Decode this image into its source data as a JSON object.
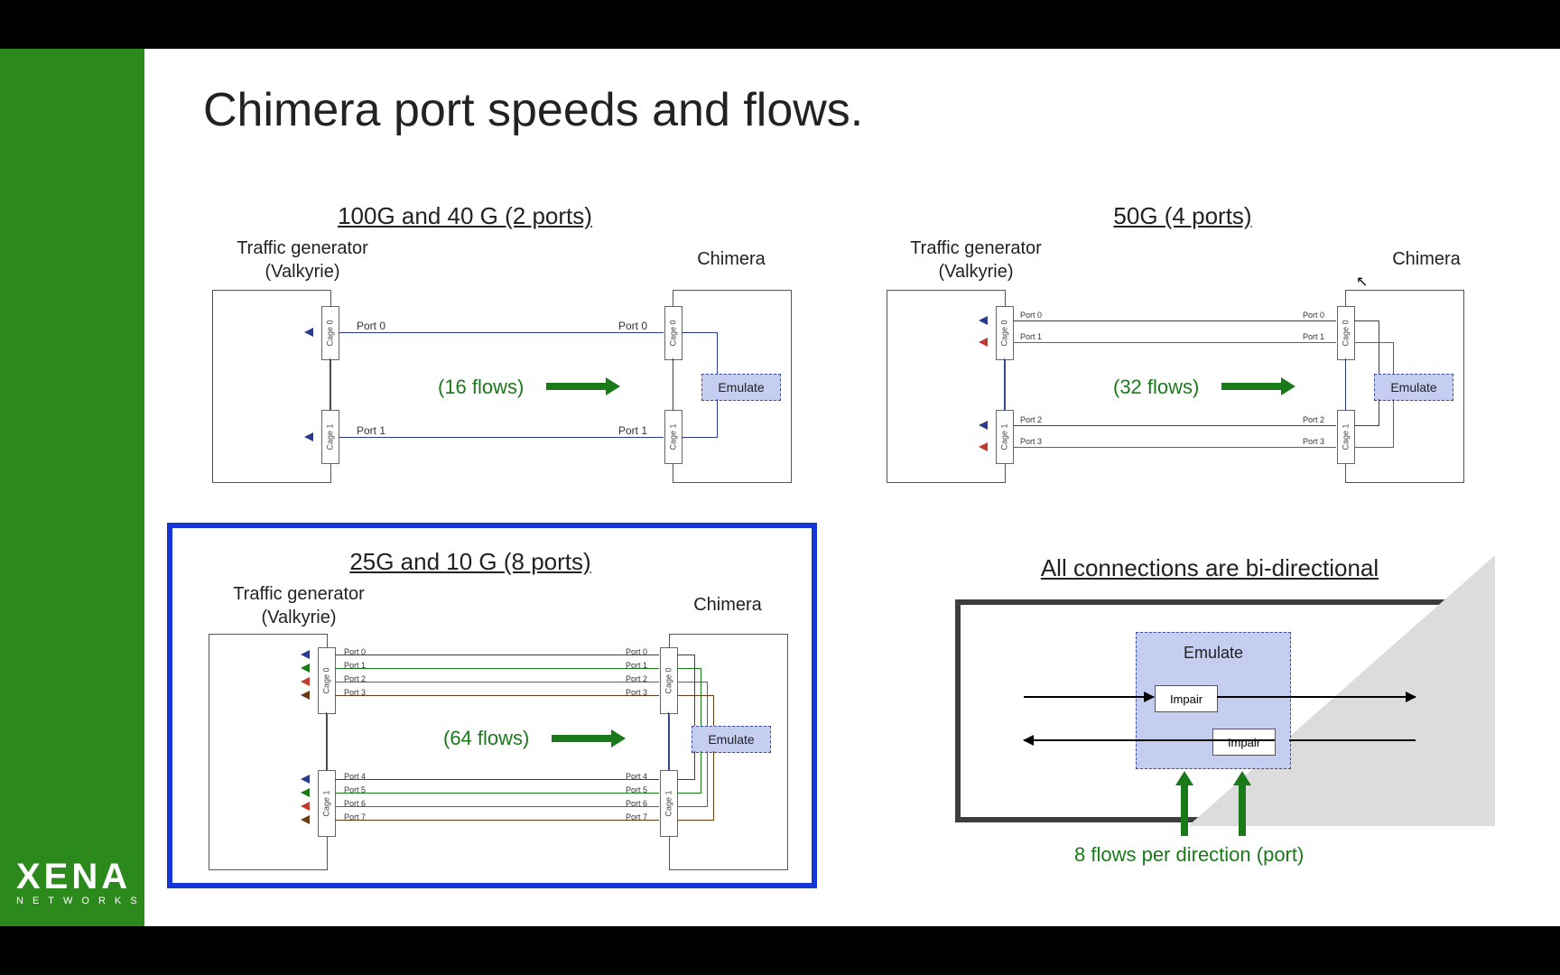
{
  "slide": {
    "title": "Chimera port speeds and flows.",
    "logo_main": "XENA",
    "logo_sub": "NETWORKS"
  },
  "groups": {
    "g100": {
      "heading": "100G and 40 G (2 ports)",
      "tg_label": "Traffic generator\n(Valkyrie)",
      "chimera_label": "Chimera",
      "cages": [
        "Cage 0",
        "Cage 1"
      ],
      "ports_left": [
        "Port 0",
        "Port 1"
      ],
      "ports_right": [
        "Port 0",
        "Port 1"
      ],
      "flows": "(16 flows)",
      "emulate": "Emulate"
    },
    "g50": {
      "heading": "50G (4 ports)",
      "tg_label": "Traffic generator\n(Valkyrie)",
      "chimera_label": "Chimera",
      "cages": [
        "Cage 0",
        "Cage 1"
      ],
      "ports_left": [
        "Port 0",
        "Port 1",
        "Port 2",
        "Port 3"
      ],
      "ports_right": [
        "Port 0",
        "Port 1",
        "Port 2",
        "Port 3"
      ],
      "flows": "(32 flows)",
      "emulate": "Emulate"
    },
    "g25": {
      "heading": "25G and 10 G (8 ports)",
      "tg_label": "Traffic generator\n(Valkyrie)",
      "chimera_label": "Chimera",
      "cages": [
        "Cage 0",
        "Cage 1"
      ],
      "ports_left": [
        "Port 0",
        "Port 1",
        "Port 2",
        "Port 3",
        "Port 4",
        "Port 5",
        "Port 6",
        "Port 7"
      ],
      "ports_right": [
        "Port 0",
        "Port 1",
        "Port 2",
        "Port 3",
        "Port 4",
        "Port 5",
        "Port 6",
        "Port 7"
      ],
      "flows": "(64 flows)",
      "emulate": "Emulate"
    },
    "bidir": {
      "heading": "All connections are bi-directional",
      "emulate": "Emulate",
      "impair": "Impair",
      "footnote": "8 flows per direction (port)"
    }
  },
  "chart_data": [
    {
      "type": "table",
      "title": "100G and 40 G",
      "ports": 2,
      "flows": 16,
      "flows_per_port_per_direction": 8
    },
    {
      "type": "table",
      "title": "50G",
      "ports": 4,
      "flows": 32,
      "flows_per_port_per_direction": 8
    },
    {
      "type": "table",
      "title": "25G and 10 G",
      "ports": 8,
      "flows": 64,
      "flows_per_port_per_direction": 8
    }
  ]
}
